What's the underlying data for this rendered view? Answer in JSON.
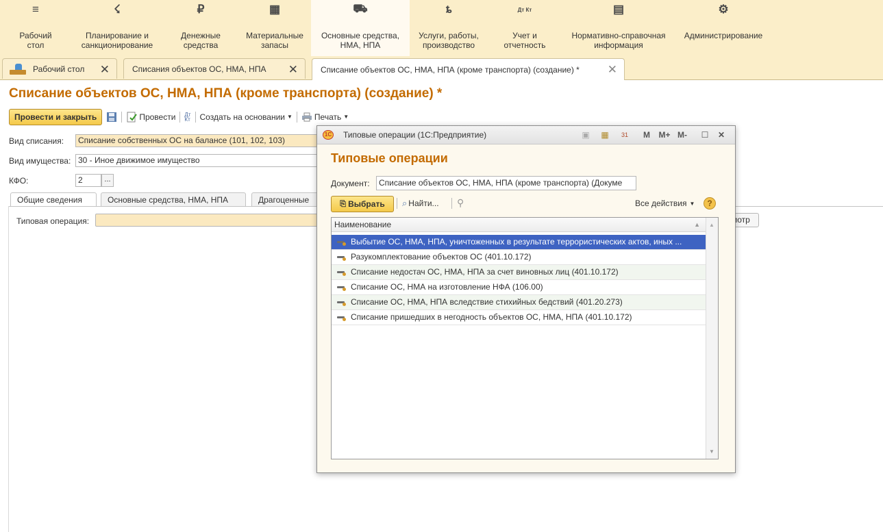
{
  "sections": [
    {
      "label": "Рабочий\nстол",
      "icon": "menu-icon",
      "glyph": "≡"
    },
    {
      "label": "Планирование и\nсанкционирование",
      "icon": "planning-icon",
      "glyph": "☇"
    },
    {
      "label": "Денежные\nсредства",
      "icon": "money-icon",
      "glyph": "₽"
    },
    {
      "label": "Материальные\nзапасы",
      "icon": "inventory-icon",
      "glyph": "▦"
    },
    {
      "label": "Основные средства,\nНМА, НПА",
      "icon": "truck-icon",
      "glyph": "⛟"
    },
    {
      "label": "Услуги, работы,\nпроизводство",
      "icon": "tools-icon",
      "glyph": "ȶ"
    },
    {
      "label": "Учет и\nотчетность",
      "icon": "accounting-icon",
      "glyph": "Дт Кт"
    },
    {
      "label": "Нормативно-справочная\nинформация",
      "icon": "reference-icon",
      "glyph": "▤"
    },
    {
      "label": "Администрирование",
      "icon": "gear-icon",
      "glyph": "⚙"
    }
  ],
  "open_tabs": [
    {
      "label": "Рабочий стол"
    },
    {
      "label": "Списания объектов ОС, НМА, НПА"
    },
    {
      "label": "Списание объектов ОС, НМА, НПА (кроме транспорта) (создание) *"
    }
  ],
  "close_glyph": "✕",
  "document": {
    "title": "Списание объектов ОС, НМА, НПА (кроме транспорта) (создание) *",
    "toolbar": {
      "post_close": "Провести и закрыть",
      "post": "Провести",
      "dt_kt": "Дт\nКт",
      "create_based": "Создать на основании",
      "print": "Печать"
    },
    "fields": {
      "write_off_type_label": "Вид списания:",
      "write_off_type_value": "Списание собственных ОС на балансе (101, 102, 103)",
      "property_type_label": "Вид имущества:",
      "property_type_value": "30 - Иное движимое имущество",
      "kfo_label": "КФО:",
      "kfo_value": "2",
      "ellipsis": "..."
    },
    "tabs": [
      "Общие сведения",
      "Основные средства, НМА, НПА",
      "Драгоценные"
    ],
    "typical_op_label": "Типовая операция:",
    "partial_button": "мотр"
  },
  "modal": {
    "window_title": "Типовые операции  (1С:Предприятие)",
    "header_buttons": [
      "M",
      "M+",
      "M-"
    ],
    "heading": "Типовые операции",
    "document_label": "Документ:",
    "document_value": "Списание объектов ОС, НМА, НПА (кроме транспорта) (Докуме",
    "choose_button": "Выбрать",
    "find_button": "Найти...",
    "all_actions": "Все действия",
    "help": "?",
    "column_header": "Наименование",
    "rows": [
      "Выбытие ОС, НМА, НПА, уничтоженных в результате террористических актов, иных ...",
      "Разукомплектование объектов ОС (401.10.172)",
      "Списание недостач ОС, НМА, НПА за счет виновных лиц (401.10.172)",
      "Списание ОС, НМА на изготовление НФА (106.00)",
      "Списание ОС, НМА, НПА вследствие стихийных бедствий (401.20.273)",
      "Списание пришедших в негодность объектов ОС, НМА, НПА (401.10.172)"
    ],
    "selected_row": 0
  },
  "colors": {
    "accent_title": "#c36b00",
    "panel_bg": "#fbeec9",
    "selection": "#3e63c2",
    "field_highlight": "#fbe9c0"
  }
}
